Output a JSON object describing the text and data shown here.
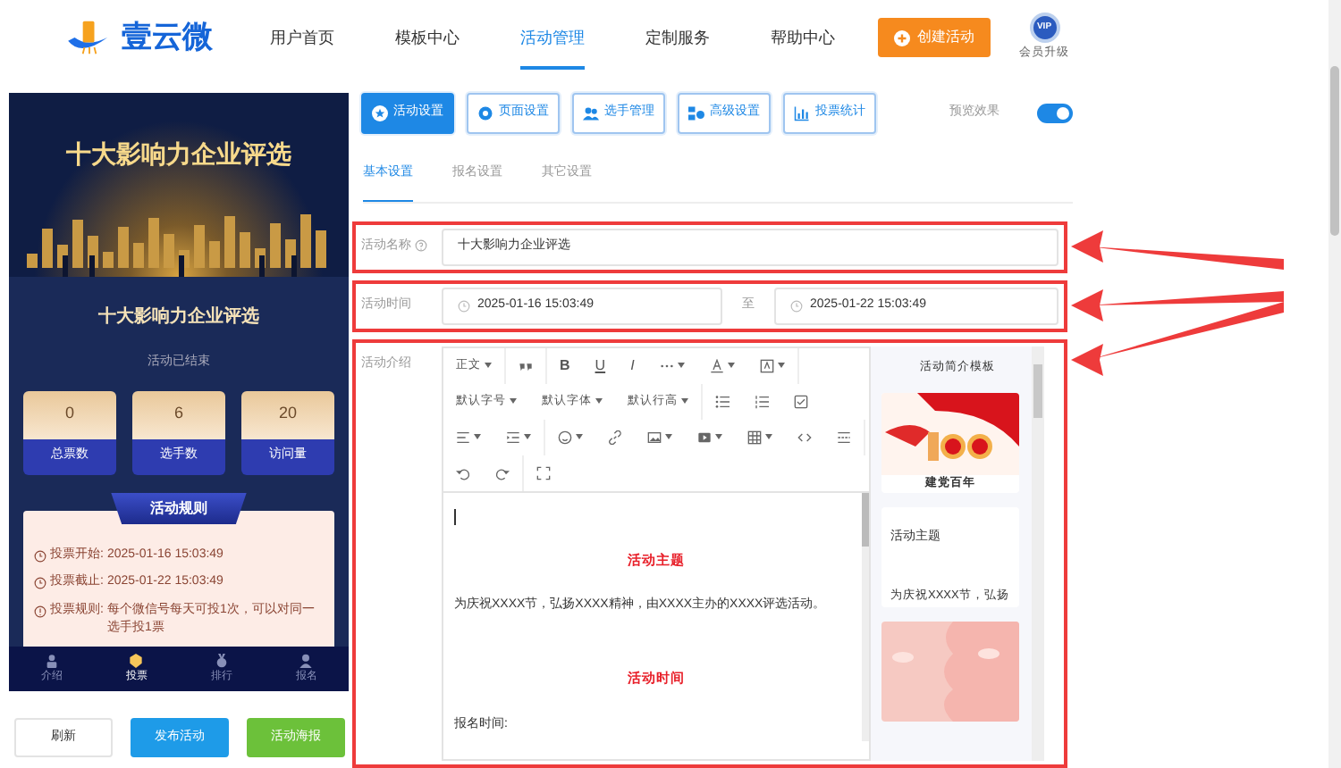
{
  "header": {
    "logo_text": "壹云微",
    "nav": [
      {
        "label": "用户首页",
        "selected": false
      },
      {
        "label": "模板中心",
        "selected": false
      },
      {
        "label": "活动管理",
        "selected": true
      },
      {
        "label": "定制服务",
        "selected": false
      },
      {
        "label": "帮助中心",
        "selected": false
      }
    ],
    "create_button": "创建活动",
    "vip_badge": "VIP",
    "vip_label": "会员升级"
  },
  "preview": {
    "banner_title": "十大影响力企业评选",
    "title": "十大影响力企业评选",
    "status": "活动已结束",
    "stats": [
      {
        "value": "0",
        "label": "总票数"
      },
      {
        "value": "6",
        "label": "选手数"
      },
      {
        "value": "20",
        "label": "访问量"
      }
    ],
    "rules_title": "活动规则",
    "rules": [
      {
        "kind": "clock",
        "label": "投票开始:",
        "text": "2025-01-16 15:03:49"
      },
      {
        "kind": "clock",
        "label": "投票截止:",
        "text": "2025-01-22 15:03:49"
      },
      {
        "kind": "info",
        "label": "投票规则:",
        "text": "每个微信号每天可投1次，可以对同一选手投1票"
      }
    ],
    "tabbar": [
      {
        "kind": "intro",
        "label": "介绍",
        "selected": false
      },
      {
        "kind": "vote",
        "label": "投票",
        "selected": true
      },
      {
        "kind": "rank",
        "label": "排行",
        "selected": false
      },
      {
        "kind": "signup",
        "label": "报名",
        "selected": false
      }
    ]
  },
  "actions": [
    {
      "kind": "plain",
      "label": "刷新"
    },
    {
      "kind": "blue",
      "label": "发布活动"
    },
    {
      "kind": "green",
      "label": "活动海报"
    }
  ],
  "settings_tabs": [
    {
      "kind": "star",
      "label": "活动设置",
      "selected": true
    },
    {
      "kind": "gear",
      "label": "页面设置",
      "selected": false
    },
    {
      "kind": "people",
      "label": "选手管理",
      "selected": false
    },
    {
      "kind": "tools",
      "label": "高级设置",
      "selected": false
    },
    {
      "kind": "chart",
      "label": "投票统计",
      "selected": false
    }
  ],
  "preview_toggle": {
    "label": "预览效果",
    "on": true
  },
  "sub_tabs": [
    {
      "label": "基本设置",
      "selected": true
    },
    {
      "label": "报名设置",
      "selected": false
    },
    {
      "label": "其它设置",
      "selected": false
    }
  ],
  "form": [
    {
      "kind": "text",
      "label": "活动名称",
      "help": true,
      "value": "十大影响力企业评选",
      "highlighted": true
    },
    {
      "kind": "daterange",
      "label": "活动时间",
      "start": "2025-01-16 15:03:49",
      "separator": "至",
      "end": "2025-01-22 15:03:49",
      "highlighted": true
    },
    {
      "kind": "editor",
      "label": "活动介绍",
      "highlighted": true
    }
  ],
  "editor": {
    "toolbar": [
      {
        "kind": "dropdown",
        "label": "正文",
        "group_end": true
      },
      {
        "kind": "quote",
        "group_end": true
      },
      {
        "kind": "bold",
        "label": "B"
      },
      {
        "kind": "underline",
        "label": "U"
      },
      {
        "kind": "italic",
        "label": "I"
      },
      {
        "kind": "more",
        "caret": true
      },
      {
        "kind": "font-color",
        "caret": true
      },
      {
        "kind": "bg-color",
        "caret": true,
        "group_end": true
      },
      {
        "kind": "dropdown",
        "label": "默认字号"
      },
      {
        "kind": "dropdown",
        "label": "默认字体"
      },
      {
        "kind": "dropdown",
        "label": "默认行高",
        "group_end": true
      },
      {
        "kind": "bullet-list"
      },
      {
        "kind": "numbered-list"
      },
      {
        "kind": "todo"
      },
      {
        "kind": "align",
        "caret": true
      },
      {
        "kind": "indent",
        "caret": true,
        "group_end": true
      },
      {
        "kind": "emoji",
        "caret": true
      },
      {
        "kind": "link"
      },
      {
        "kind": "image",
        "caret": true
      },
      {
        "kind": "video",
        "caret": true
      },
      {
        "kind": "table",
        "caret": true
      },
      {
        "kind": "code"
      },
      {
        "kind": "divider",
        "group_end": true
      },
      {
        "kind": "undo"
      },
      {
        "kind": "redo",
        "group_end": true
      },
      {
        "kind": "fullscreen"
      }
    ],
    "content": [
      {
        "kind": "heading",
        "text": "活动主题"
      },
      {
        "kind": "paragraph",
        "text": "为庆祝XXXX节，弘扬XXXX精神，由XXXX主办的XXXX评选活动。"
      },
      {
        "kind": "heading",
        "text": "活动时间"
      },
      {
        "kind": "paragraph",
        "text": "报名时间:"
      }
    ],
    "templates_title": "活动简介模板",
    "templates": [
      {
        "kind": "flag-image",
        "caption": "建党百年"
      },
      {
        "kind": "text",
        "title": "活动主题",
        "text": "为庆祝XXXX节，弘扬"
      },
      {
        "kind": "pink-image"
      }
    ]
  }
}
